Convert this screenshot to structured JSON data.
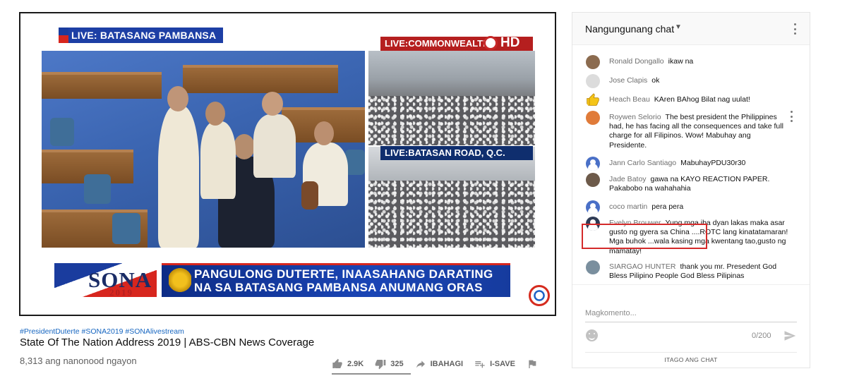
{
  "video": {
    "live_label_main": "LIVE: BATASANG PAMBANSA",
    "live_label_top_right": "LIVE:COMMONWEALTH",
    "hd_badge": "HD",
    "live_label_bottom_right": "LIVE:BATASAN ROAD, Q.C.",
    "sona_word": "SONA",
    "sona_year": "2019",
    "headline_line1": "PANGULONG DUTERTE, INAASAHANG DARATING",
    "headline_line2": "NA SA BATASANG PAMBANSA ANUMANG ORAS"
  },
  "meta": {
    "hashtags": "#PresidentDuterte #SONA2019 #SONAlivestream",
    "title": "State Of The Nation Address 2019 | ABS-CBN News Coverage",
    "views": "8,313 ang nanonood ngayon"
  },
  "actions": {
    "likes": "2.9K",
    "dislikes": "325",
    "share": "IBAHAGI",
    "save": "I-SAVE"
  },
  "chat": {
    "title": "Nangungunang chat",
    "messages": [
      {
        "author": "Ronald Dongallo",
        "text": "ikaw na",
        "avatar": "photo-man-hat"
      },
      {
        "author": "Jose Clapis",
        "text": "ok",
        "avatar": "photo-man-suit"
      },
      {
        "author": "Heach Beau",
        "text": "KAren BAhog Bilat nag uulat!",
        "avatar": "thumbs-up-icon"
      },
      {
        "author": "Roywen Selorio",
        "text": "The best president the Philippines had, he has facing all the consequences and take full charge for all Filipinos. Wow! Mabuhay ang Presidente.",
        "avatar": "photo-orange"
      },
      {
        "author": "Jann Carlo Santiago",
        "text": "MabuhayPDU30r30",
        "avatar": "default-avatar"
      },
      {
        "author": "Jade Batoy",
        "text": "gawa na KAYO REACTION PAPER. Pakabobo na wahahahia",
        "avatar": "photo-person"
      },
      {
        "author": "coco martin",
        "text": "pera pera",
        "avatar": "default-avatar"
      },
      {
        "author": "Evelyn Brouwer",
        "text": "Yung mga iba dyan lakas maka asar gusto ng gyera sa China ....ROTC lang kinatatamaran! Mga buhok ...wala kasing mga kwentang tao,gusto ng mamatay!",
        "avatar": "default-avatar-dark"
      },
      {
        "author": "SIARGAO HUNTER",
        "text": "thank you mr. Presedent God Bless Pilipino People God Bless Pilipinas",
        "avatar": "photo-landscape"
      }
    ],
    "compose_placeholder": "Magkomento...",
    "char_counter": "0/200",
    "hide_chat": "ITAGO ANG CHAT"
  },
  "colors": {
    "brand_blue": "#1d3fa5",
    "brand_red": "#b51f1f",
    "highlight_red": "#d42a2a",
    "link_blue": "#1565c0",
    "jump_button": "#2196f3"
  }
}
